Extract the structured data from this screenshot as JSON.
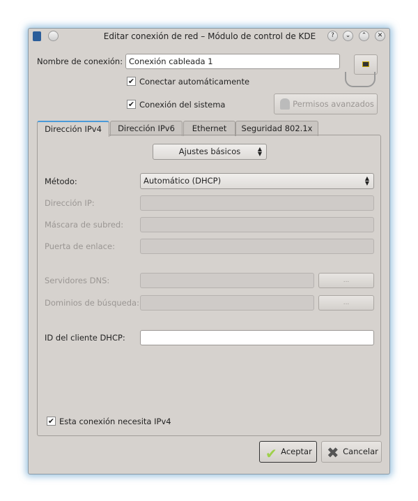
{
  "window": {
    "title": "Editar conexión de red – Módulo de control de KDE",
    "help": "?",
    "minimize": "⌄",
    "maximize": "⌃",
    "close": "✕"
  },
  "form": {
    "name_label": "Nombre de conexión:",
    "name_value": "Conexión cableada 1",
    "auto_connect": {
      "label": "Conectar automáticamente",
      "checked": true
    },
    "system_connection": {
      "label": "Conexión del sistema",
      "checked": true
    },
    "advanced_permissions": "Permisos avanzados"
  },
  "tabs": [
    {
      "label": "Dirección IPv4",
      "active": true
    },
    {
      "label": "Dirección IPv6"
    },
    {
      "label": "Ethernet"
    },
    {
      "label": "Seguridad 802.1x"
    }
  ],
  "ipv4": {
    "settings_mode": "Ajustes básicos",
    "method_label": "Método:",
    "method_value": "Automático (DHCP)",
    "ip_label": "Dirección IP:",
    "mask_label": "Máscara de subred:",
    "gateway_label": "Puerta de enlace:",
    "dns_label": "Servidores DNS:",
    "search_label": "Dominios de búsqueda:",
    "more": "...",
    "dhcp_id_label": "ID del cliente DHCP:",
    "dhcp_id_value": "",
    "requires_ipv4": {
      "label": "Esta conexión necesita IPv4",
      "checked": true
    }
  },
  "buttons": {
    "ok": "Aceptar",
    "cancel": "Cancelar"
  }
}
